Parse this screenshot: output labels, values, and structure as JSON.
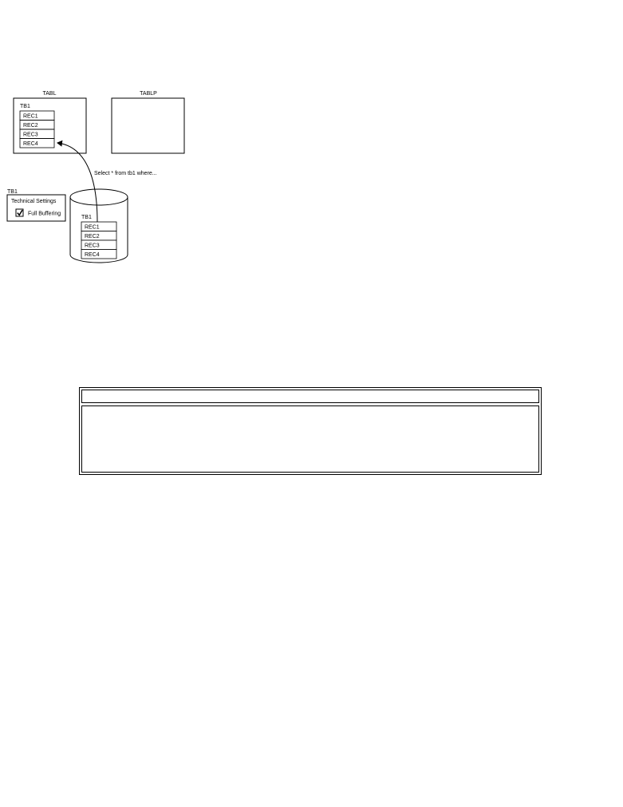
{
  "diagram": {
    "app_server": {
      "buffer_tabl_label": "TABL",
      "buffer_tablp_label": "TABLP",
      "buffered_table": {
        "name": "TB1",
        "records": [
          "REC1",
          "REC2",
          "REC3",
          "REC4"
        ]
      }
    },
    "settings_panel": {
      "table_name": "TB1",
      "title": "Technical Settings",
      "option_label": "Full Buffering",
      "option_checked": true
    },
    "database": {
      "table_name": "TB1",
      "records": [
        "REC1",
        "REC2",
        "REC3",
        "REC4"
      ]
    },
    "query_label": "Select * from tb1 where..."
  },
  "note_box": {
    "header": "",
    "body": ""
  }
}
